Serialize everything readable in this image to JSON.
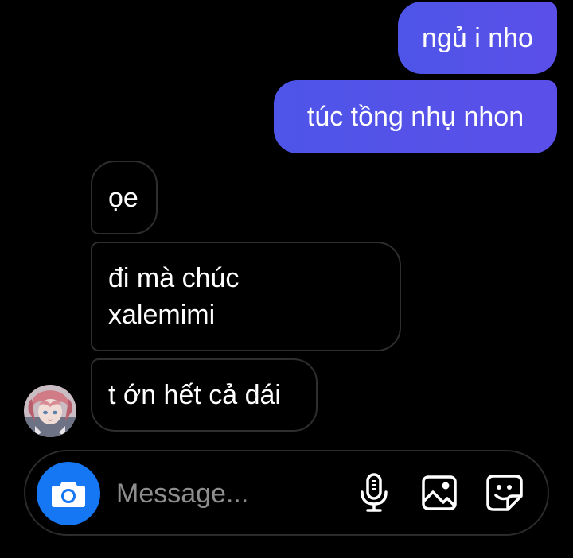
{
  "messages": {
    "sent": [
      {
        "text": "ngủ i nho"
      },
      {
        "text": "túc tồng nhụ nhon"
      }
    ],
    "received": [
      {
        "text": "ọe"
      },
      {
        "text": "đi mà chúc xalemimi"
      },
      {
        "text": "t ớn hết cả dái"
      }
    ]
  },
  "composer": {
    "placeholder": "Message..."
  },
  "icons": {
    "camera": "camera-icon",
    "mic": "microphone-icon",
    "gallery": "image-icon",
    "sticker": "sticker-icon"
  },
  "colors": {
    "sent_bubble": "#5050e8",
    "camera_button": "#1577f3",
    "received_border": "#2e2e2e",
    "background": "#000000"
  }
}
